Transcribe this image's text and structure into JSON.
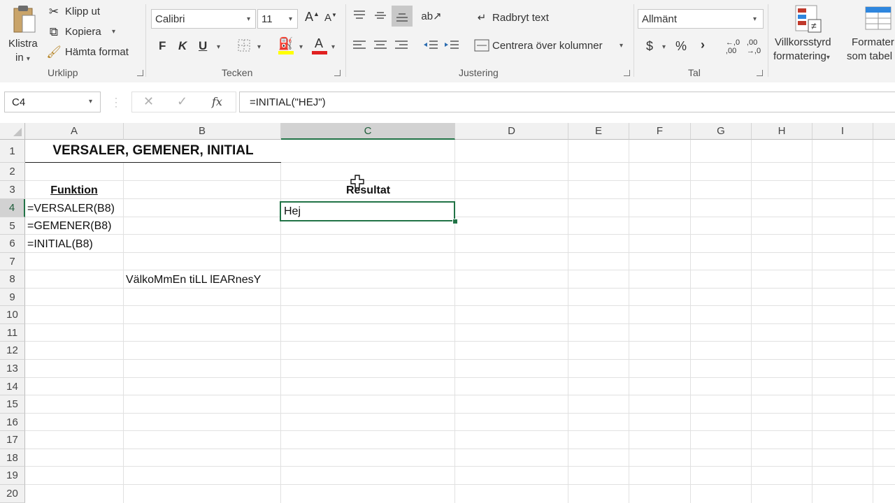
{
  "ribbon": {
    "clipboard": {
      "paste_label_line1": "Klistra",
      "paste_label_line2": "in",
      "cut_label": "Klipp ut",
      "copy_label": "Kopiera",
      "format_painter_label": "Hämta format",
      "group_label": "Urklipp"
    },
    "font": {
      "font_name": "Calibri",
      "font_size": "11",
      "bold_label": "F",
      "italic_label": "K",
      "underline_label": "U",
      "grow_label": "A",
      "shrink_label": "A",
      "font_color_label": "A",
      "group_label": "Tecken"
    },
    "alignment": {
      "wrap_text_label": "Radbryt text",
      "merge_center_label": "Centrera över kolumner",
      "group_label": "Justering"
    },
    "number": {
      "format_value": "Allmänt",
      "currency_label": "$",
      "percent_label": "%",
      "comma_label": "›",
      "group_label": "Tal"
    },
    "styles": {
      "conditional_line1": "Villkorsstyrd",
      "conditional_line2": "formatering",
      "format_table_line1": "Formater",
      "format_table_line2": "som tabel"
    }
  },
  "formula_bar": {
    "name_box": "C4",
    "fx_label": "fx",
    "formula": "=INITIAL(\"HEJ\")"
  },
  "grid": {
    "columns": [
      "A",
      "B",
      "C",
      "D",
      "E",
      "F",
      "G",
      "H",
      "I"
    ],
    "rows": [
      "1",
      "2",
      "3",
      "4",
      "5",
      "6",
      "7",
      "8",
      "9",
      "10",
      "11",
      "12",
      "13",
      "14",
      "15",
      "16",
      "17",
      "18",
      "19",
      "20"
    ],
    "cells": {
      "A1": "VERSALER, GEMENER, INITIAL",
      "A3": "Funktion",
      "A4": "=VERSALER(B8)",
      "A5": "=GEMENER(B8)",
      "A6": "=INITIAL(B8)",
      "B8": "VälkoMmEn tiLL lEARnesY",
      "C3": "Resultat",
      "C4": "Hej"
    },
    "selected_cell": "C4",
    "accent_color": "#217346"
  }
}
